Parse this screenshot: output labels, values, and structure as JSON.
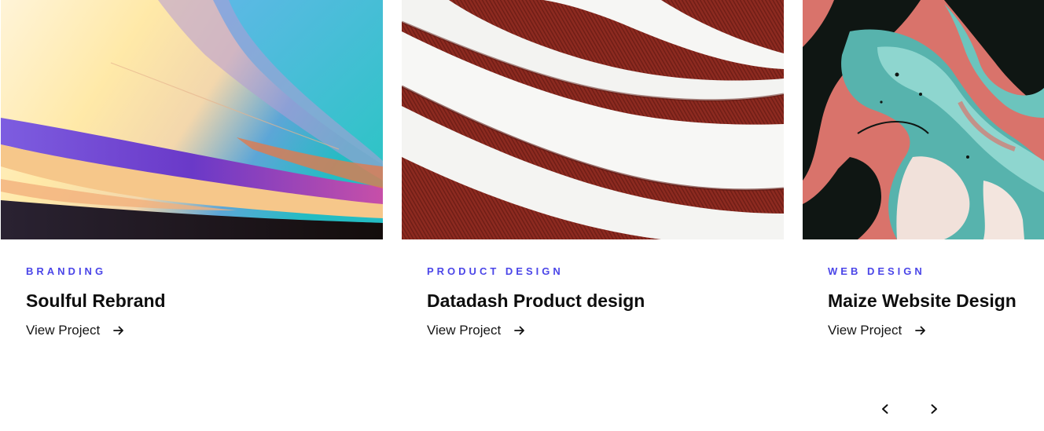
{
  "colors": {
    "accent": "#4b46e8",
    "text": "#0e0e0e"
  },
  "projects": [
    {
      "category": "BRANDING",
      "title": "Soulful Rebrand",
      "link_label": "View Project",
      "image": "abstract-light-streaks"
    },
    {
      "category": "PRODUCT DESIGN",
      "title": "Datadash Product design",
      "link_label": "View Project",
      "image": "curved-white-stripes-on-red"
    },
    {
      "category": "WEB DESIGN",
      "title": "Maize Website Design",
      "link_label": "View Project",
      "image": "teal-and-coral-marble"
    }
  ],
  "navigation": {
    "prev_icon": "chevron-left-icon",
    "next_icon": "chevron-right-icon"
  }
}
